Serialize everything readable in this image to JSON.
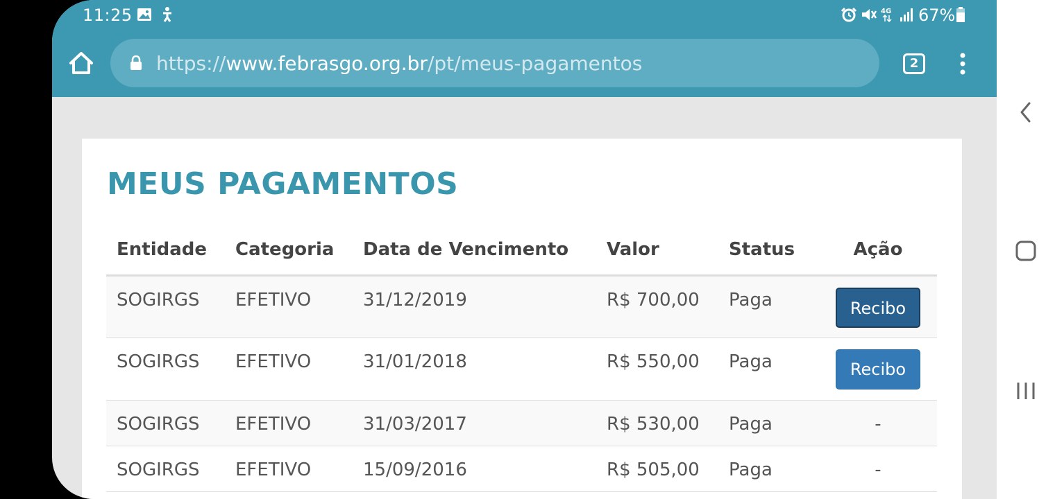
{
  "status_bar": {
    "time": "11:25",
    "battery": "67%",
    "network": "4G"
  },
  "browser": {
    "url_prefix": "https://",
    "url_domain": "www.febrasgo.org.br",
    "url_path": "/pt/meus-pagamentos",
    "tab_count": "2"
  },
  "page": {
    "title": "MEUS PAGAMENTOS"
  },
  "table": {
    "headers": {
      "entidade": "Entidade",
      "categoria": "Categoria",
      "vencimento": "Data de Vencimento",
      "valor": "Valor",
      "status": "Status",
      "acao": "Ação"
    },
    "rows": [
      {
        "entidade": "SOGIRGS",
        "categoria": "EFETIVO",
        "vencimento": "31/12/2019",
        "valor": "R$ 700,00",
        "status": "Paga",
        "acao": "Recibo"
      },
      {
        "entidade": "SOGIRGS",
        "categoria": "EFETIVO",
        "vencimento": "31/01/2018",
        "valor": "R$ 550,00",
        "status": "Paga",
        "acao": "Recibo"
      },
      {
        "entidade": "SOGIRGS",
        "categoria": "EFETIVO",
        "vencimento": "31/03/2017",
        "valor": "R$ 530,00",
        "status": "Paga",
        "acao": "-"
      },
      {
        "entidade": "SOGIRGS",
        "categoria": "EFETIVO",
        "vencimento": "15/09/2016",
        "valor": "R$ 505,00",
        "status": "Paga",
        "acao": "-"
      }
    ]
  },
  "colors": {
    "toolbar": "#3d99b1",
    "title": "#3a96ad",
    "button_pressed": "#286090",
    "button": "#337ab7"
  },
  "icons": {
    "status": [
      "gallery-icon",
      "accessibility-icon",
      "alarm-icon",
      "mute-icon",
      "network-4g-icon",
      "signal-icon",
      "battery-icon"
    ],
    "browser": [
      "home-icon",
      "lock-icon",
      "tabs-icon",
      "menu-icon"
    ],
    "navigation": [
      "back-icon",
      "home-button-icon",
      "recents-icon"
    ]
  }
}
